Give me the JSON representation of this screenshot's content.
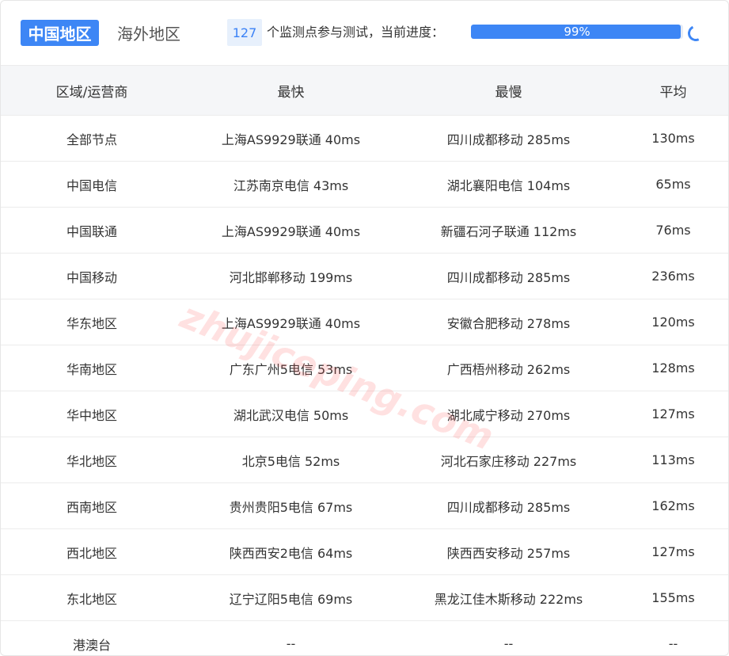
{
  "tabs": {
    "china": "中国地区",
    "overseas": "海外地区"
  },
  "monitor": {
    "count": "127",
    "text": "个监测点参与测试，当前进度：",
    "progress_label": "99%",
    "progress_fraction": 0.99
  },
  "table": {
    "headers": [
      "区域/运营商",
      "最快",
      "最慢",
      "平均"
    ],
    "rows": [
      [
        "全部节点",
        "上海AS9929联通 40ms",
        "四川成都移动 285ms",
        "130ms"
      ],
      [
        "中国电信",
        "江苏南京电信 43ms",
        "湖北襄阳电信 104ms",
        "65ms"
      ],
      [
        "中国联通",
        "上海AS9929联通 40ms",
        "新疆石河子联通 112ms",
        "76ms"
      ],
      [
        "中国移动",
        "河北邯郸移动 199ms",
        "四川成都移动 285ms",
        "236ms"
      ],
      [
        "华东地区",
        "上海AS9929联通 40ms",
        "安徽合肥移动 278ms",
        "120ms"
      ],
      [
        "华南地区",
        "广东广州5电信 53ms",
        "广西梧州移动 262ms",
        "128ms"
      ],
      [
        "华中地区",
        "湖北武汉电信 50ms",
        "湖北咸宁移动 270ms",
        "127ms"
      ],
      [
        "华北地区",
        "北京5电信 52ms",
        "河北石家庄移动 227ms",
        "113ms"
      ],
      [
        "西南地区",
        "贵州贵阳5电信 67ms",
        "四川成都移动 285ms",
        "162ms"
      ],
      [
        "西北地区",
        "陕西西安2电信 64ms",
        "陕西西安移动 257ms",
        "127ms"
      ],
      [
        "东北地区",
        "辽宁辽阳5电信 69ms",
        "黑龙江佳木斯移动 222ms",
        "155ms"
      ],
      [
        "港澳台",
        "--",
        "--",
        "--"
      ]
    ]
  },
  "watermark": "zhujiceping.com",
  "colors": {
    "accent": "#3d86f5",
    "badge_bg": "#e7f0fc",
    "header_bg": "#f5f6f8"
  }
}
